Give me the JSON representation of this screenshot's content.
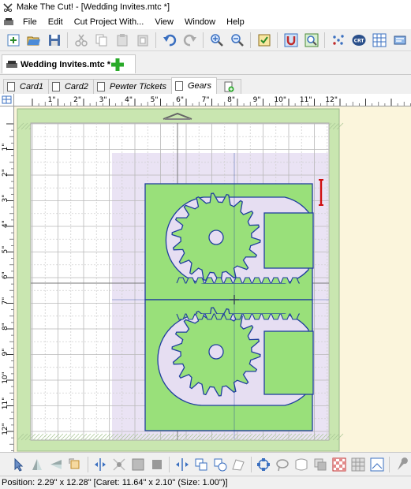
{
  "window": {
    "title": "Make The Cut! - [Wedding Invites.mtc *]"
  },
  "menu": {
    "items": [
      "File",
      "Edit",
      "Cut Project With...",
      "View",
      "Window",
      "Help"
    ]
  },
  "document_tab": {
    "label": "Wedding Invites.mtc *"
  },
  "page_tabs": [
    {
      "label": "Card1"
    },
    {
      "label": "Card2"
    },
    {
      "label": "Pewter Tickets"
    },
    {
      "label": "Gears",
      "active": true
    }
  ],
  "ruler": {
    "h_labels": [
      "1\"",
      "2\"",
      "3\"",
      "4\"",
      "5\"",
      "6\"",
      "7\"",
      "8\"",
      "9\"",
      "10\"",
      "11\"",
      "12\""
    ],
    "v_labels": [
      "1\"",
      "2\"",
      "3\"",
      "4\"",
      "5\"",
      "6\"",
      "7\"",
      "8\"",
      "9\"",
      "10\"",
      "11\"",
      "12\""
    ]
  },
  "colors": {
    "mat_green": "#c9e6b0",
    "shape_green": "#99e07a",
    "outline_blue": "#1f3e9e",
    "selection_purple": "#e6def2",
    "handle_red": "#d01010",
    "workspace": "#fbf5dc"
  },
  "status": {
    "text": "Position: 2.29\" x 12.28\" [Caret: 11.64\" x 2.10\" (Size: 1.00\")]"
  }
}
